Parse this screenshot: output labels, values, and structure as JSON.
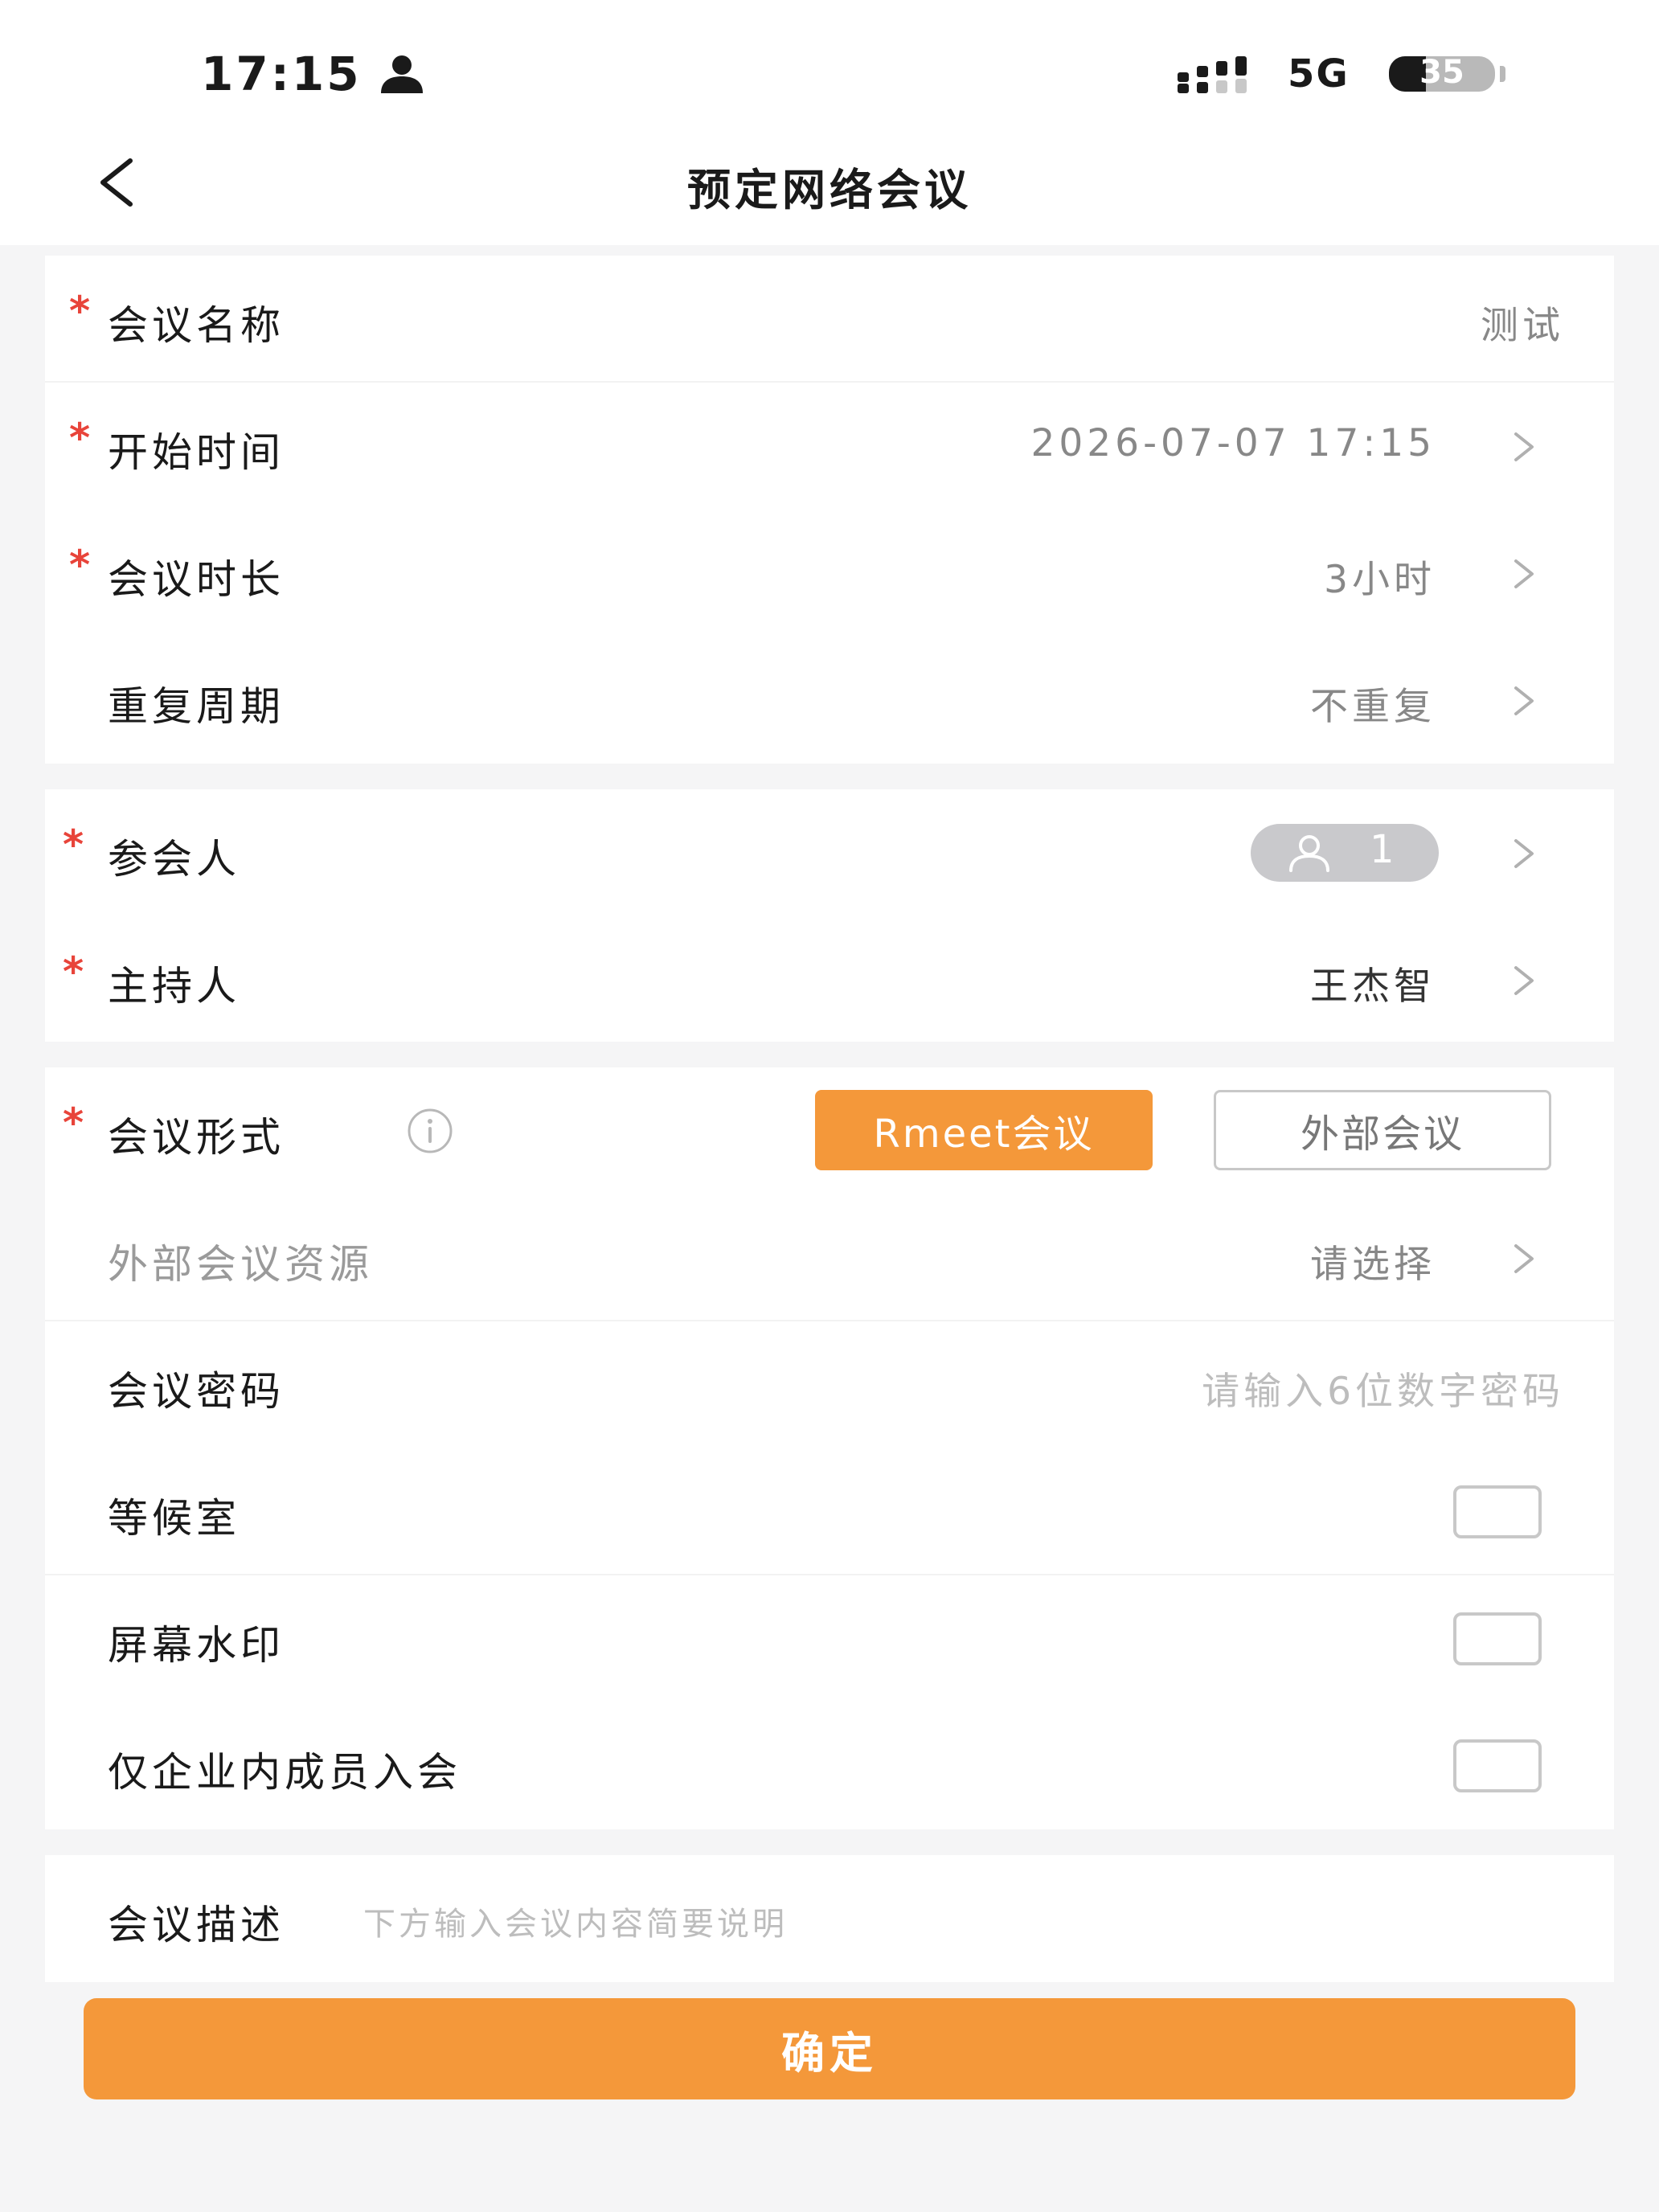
{
  "status_bar": {
    "time": "17:15",
    "network": "5G",
    "battery_level": 35,
    "battery_text": "35",
    "icons": [
      "person-icon",
      "signal-icon",
      "battery-icon"
    ]
  },
  "header": {
    "title": "预定网络会议",
    "back_icon": "chevron-left-icon"
  },
  "basic": {
    "meeting_name": {
      "label": "会议名称",
      "value": "测试",
      "required": true
    },
    "start_time": {
      "label": "开始时间",
      "value": "2026-07-07 17:15",
      "required": true
    },
    "duration": {
      "label": "会议时长",
      "value": "3小时",
      "required": true
    },
    "repeat": {
      "label": "重复周期",
      "value": "不重复",
      "required": false
    }
  },
  "people": {
    "participants": {
      "label": "参会人",
      "count": "1",
      "required": true
    },
    "host": {
      "label": "主持人",
      "value": "王杰智",
      "required": true
    }
  },
  "settings": {
    "format": {
      "label": "会议形式",
      "options": [
        "Rmeet会议",
        "外部会议"
      ],
      "selected": "Rmeet会议",
      "required": true
    },
    "external_resource": {
      "label": "外部会议资源",
      "placeholder": "请选择"
    },
    "password": {
      "label": "会议密码",
      "placeholder": "请输入6位数字密码"
    },
    "waiting_room": {
      "label": "等候室",
      "checked": false
    },
    "watermark": {
      "label": "屏幕水印",
      "checked": false
    },
    "internal_only": {
      "label": "仅企业内成员入会",
      "checked": false
    }
  },
  "description": {
    "label": "会议描述",
    "placeholder": "下方输入会议内容简要说明"
  },
  "confirm_label": "确定",
  "required_mark": "*",
  "colors": {
    "accent": "#f4983a",
    "required": "#e8443a",
    "background": "#f5f5f6"
  }
}
